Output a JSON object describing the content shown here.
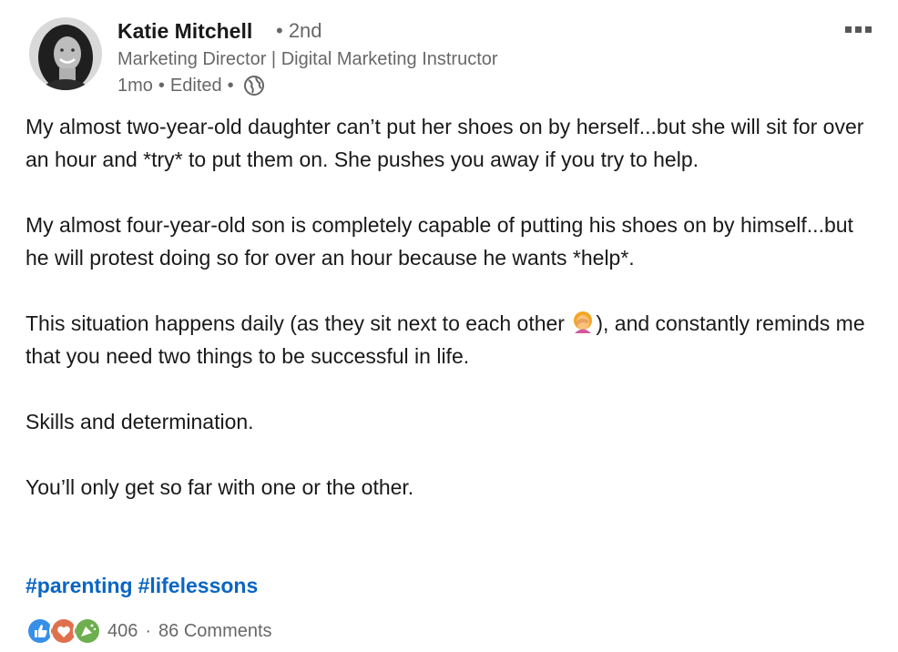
{
  "post": {
    "author": {
      "name": "Katie Mitchell",
      "degree": "• 2nd",
      "headline": "Marketing Director | Digital Marketing Instructor"
    },
    "meta": {
      "time": "1mo",
      "sep1": "•",
      "edited": "Edited",
      "sep2": "•",
      "visibility_icon": "globe-icon"
    },
    "paragraphs": {
      "p1": "My almost two-year-old daughter can’t put her shoes on by herself...but she will sit for over an hour and *try* to put them on. She pushes you away if you try to help.",
      "p2": "My almost four-year-old son is completely capable of putting his shoes on by himself...but he will protest doing so for over an hour because he wants *help*.",
      "p3a": "This situation happens daily (as they sit next to each other ",
      "p3b": "), and constantly reminds me that you need two things to be successful in life.",
      "p4": "Skills and determination.",
      "p5": "You’ll only get so far with one or the other."
    },
    "hashtags": [
      "#parenting",
      "#lifelessons"
    ],
    "social": {
      "reactions": [
        "like-icon",
        "love-icon",
        "celebrate-icon"
      ],
      "reaction_count": "406",
      "sep": "·",
      "comments": "86 Comments"
    },
    "colors": {
      "link": "#0a66c2",
      "like": "#378fe9",
      "love": "#df704d",
      "celebrate": "#6dae4f"
    }
  }
}
